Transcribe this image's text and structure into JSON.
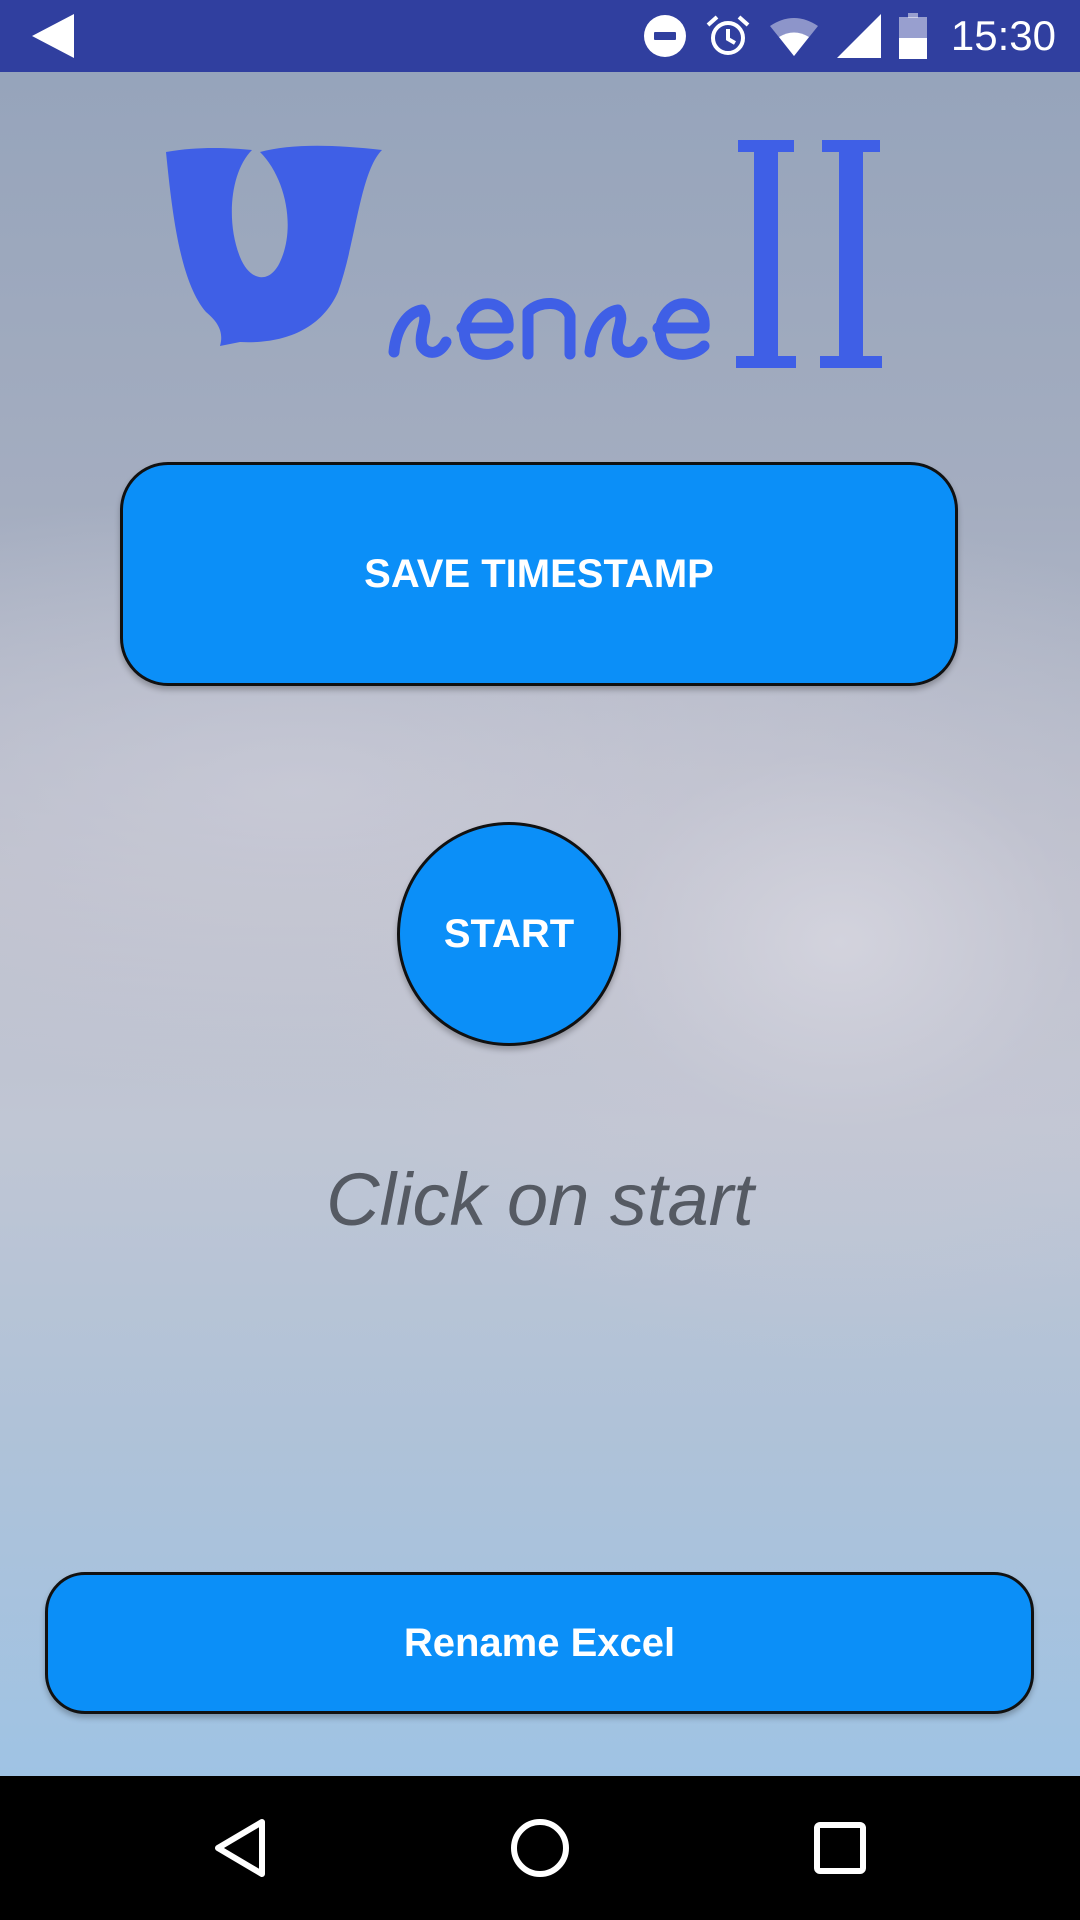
{
  "status_bar": {
    "time": "15:30",
    "icons": [
      "back-arrow-icon",
      "do-not-disturb-icon",
      "alarm-icon",
      "wifi-icon",
      "cell-signal-icon",
      "battery-icon"
    ]
  },
  "logo": {
    "text": "Usense",
    "numeral": "II",
    "color": "#3f5fe6"
  },
  "buttons": {
    "save_timestamp": "SAVE TIMESTAMP",
    "start": "START",
    "rename_excel": "Rename Excel"
  },
  "hint": "Click on start",
  "colors": {
    "status_bar": "#303f9f",
    "button": "#0b8ff8",
    "button_text": "#ffffff",
    "hint_text": "#555a63"
  },
  "nav_bar": {
    "icons": [
      "nav-back-icon",
      "nav-home-icon",
      "nav-recents-icon"
    ]
  }
}
